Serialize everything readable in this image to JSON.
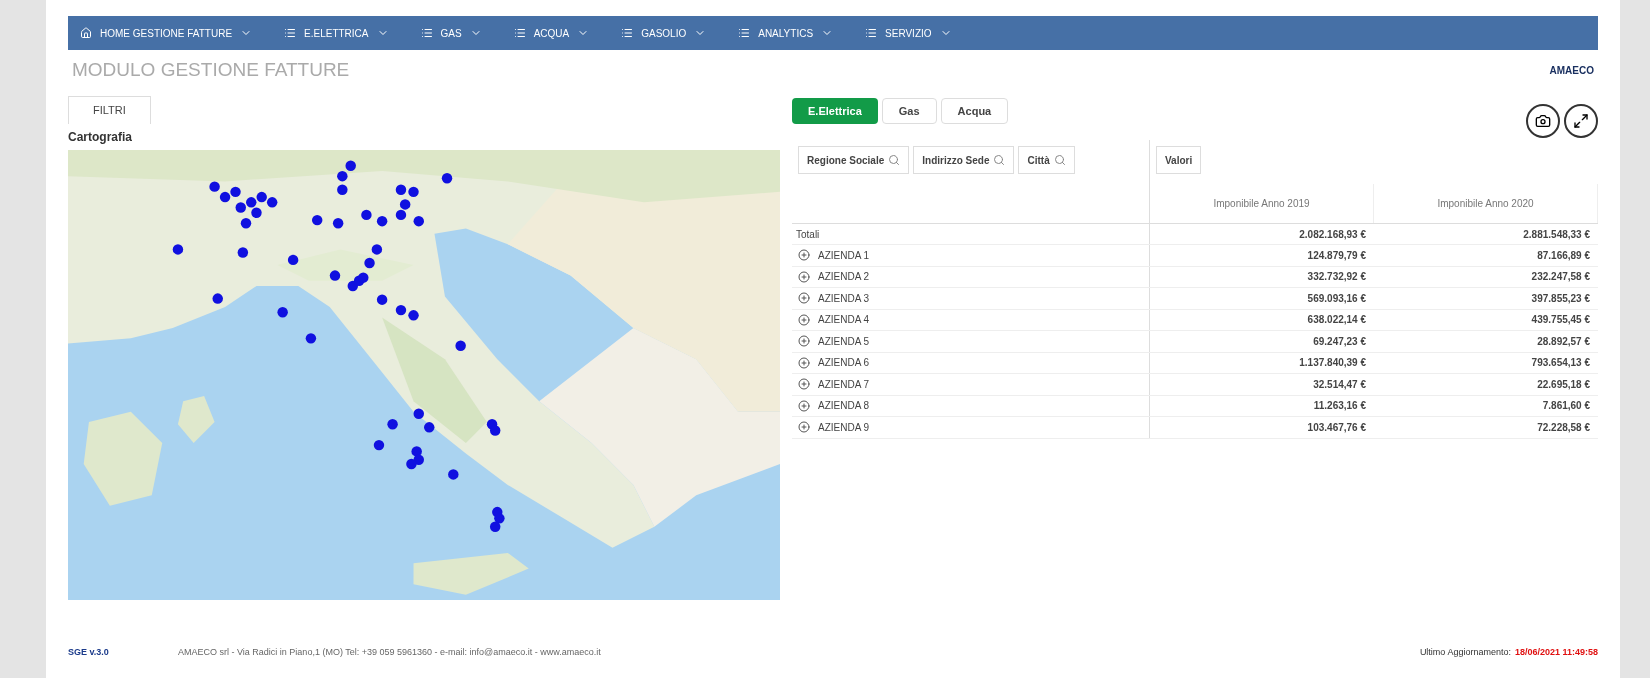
{
  "nav": [
    {
      "label": "HOME GESTIONE FATTURE",
      "kind": "home"
    },
    {
      "label": "E.ELETTRICA",
      "kind": "list"
    },
    {
      "label": "GAS",
      "kind": "list"
    },
    {
      "label": "ACQUA",
      "kind": "list"
    },
    {
      "label": "GASOLIO",
      "kind": "list"
    },
    {
      "label": "ANALYTICS",
      "kind": "list"
    },
    {
      "label": "SERVIZIO",
      "kind": "list"
    }
  ],
  "title": "MODULO GESTIONE FATTURE",
  "logo": "AMAECO",
  "filter_tab": "FILTRI",
  "map_title": "Cartografia",
  "map": {
    "kind": "picture"
  },
  "energy_tabs": [
    {
      "label": "E.Elettrica",
      "selected": true
    },
    {
      "label": "Gas",
      "selected": false
    },
    {
      "label": "Acqua",
      "selected": false
    }
  ],
  "dimension_filters": [
    "Regione Sociale",
    "Indirizzo Sede",
    "Città"
  ],
  "values_label": "Valori",
  "columns": [
    "Imponibile Anno 2019",
    "Imponibile Anno 2020"
  ],
  "totals": {
    "label": "Totali",
    "values": [
      "2.082.168,93 €",
      "2.881.548,33 €"
    ]
  },
  "rows": [
    {
      "name": "AZIENDA 1",
      "values": [
        "124.879,79 €",
        "87.166,89 €"
      ]
    },
    {
      "name": "AZIENDA 2",
      "values": [
        "332.732,92 €",
        "232.247,58 €"
      ]
    },
    {
      "name": "AZIENDA 3",
      "values": [
        "569.093,16 €",
        "397.855,23 €"
      ]
    },
    {
      "name": "AZIENDA 4",
      "values": [
        "638.022,14 €",
        "439.755,45 €"
      ]
    },
    {
      "name": "AZIENDA 5",
      "values": [
        "69.247,23 €",
        "28.892,57 €"
      ]
    },
    {
      "name": "AZIENDA 6",
      "values": [
        "1.137.840,39 €",
        "793.654,13 €"
      ]
    },
    {
      "name": "AZIENDA 7",
      "values": [
        "32.514,47 €",
        "22.695,18 €"
      ]
    },
    {
      "name": "AZIENDA 8",
      "values": [
        "11.263,16 €",
        "7.861,60 €"
      ]
    },
    {
      "name": "AZIENDA 9",
      "values": [
        "103.467,76 €",
        "72.228,58 €"
      ]
    }
  ],
  "footer": {
    "version": "SGE v.3.0",
    "company": "AMAECO srl - Via Radici in Piano,1 (MO) Tel: +39 059 5961360 - e-mail: info@amaeco.it - www.amaeco.it",
    "update_label": "Ultimo Aggiornamento:",
    "update_time": "18/06/2021 11:49:58"
  }
}
